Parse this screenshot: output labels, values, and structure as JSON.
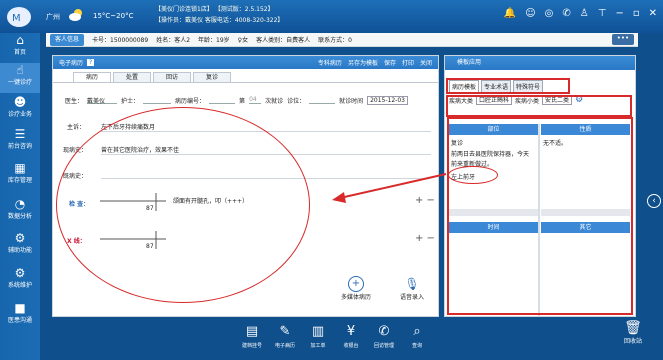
{
  "topbar": {
    "city": "广州",
    "temp": "15°C~20°C",
    "info1": "【美仪门诊连锁1店】  【测试版：2.5.152】",
    "info2": "【操作员：戴美仪  客服电话：4008-320-322】"
  },
  "sidebar": [
    {
      "label": "首页",
      "icon": "home-icon"
    },
    {
      "label": "一键诊疗",
      "icon": "hand-icon"
    },
    {
      "label": "诊疗业务",
      "icon": "doctor-icon"
    },
    {
      "label": "前台咨询",
      "icon": "counter-icon"
    },
    {
      "label": "库存管理",
      "icon": "store-icon"
    },
    {
      "label": "数据分析",
      "icon": "chart-icon"
    },
    {
      "label": "辅助功能",
      "icon": "gear-icon"
    },
    {
      "label": "系统维护",
      "icon": "system-icon"
    },
    {
      "label": "医患沟通",
      "icon": "video-icon"
    }
  ],
  "patient": {
    "btn": "客人信息",
    "card": "卡号：1500000089",
    "name": "姓名：客人2",
    "age": "年龄：19岁",
    "gender": "♀女",
    "type": "客人类别：自费客人",
    "contact": "联系方式：0"
  },
  "more_btn": "•••",
  "main": {
    "title": "电子病历",
    "hbtn1": "专科病历",
    "hbtn2": "另存为模板",
    "hbtn3": "保存",
    "hbtn4": "打印",
    "hbtn5": "关闭",
    "tabs": [
      "病历",
      "处置",
      "回访",
      "复诊"
    ],
    "doctor_lbl": "医生：",
    "doctor_val": "戴美仪",
    "nurse_lbl": "护士：",
    "case_lbl": "病历编号：",
    "visit_lbl": "第",
    "visit_no": "04",
    "visit_suffix": "次就诊",
    "room_lbl": "诊位：",
    "time_lbl": "就诊时间",
    "date": "2015-12-03",
    "complaint_lbl": "主诉：",
    "complaint": "左下后牙持续痛数月",
    "present_lbl": "现病史：",
    "present": "曾在其它医院治疗，效果不佳",
    "past_lbl": "既病史：",
    "check_lbl": "检 查：",
    "check_text": "颌面有开髓孔，叩（+++）",
    "check_tooth": "87",
    "xray_lbl": "X 线：",
    "xray_tooth": "87",
    "media_btn": "多媒体病历",
    "voice_btn": "语音录入"
  },
  "right": {
    "title": "模板应用",
    "tabs": [
      "病历模板",
      "专业术语",
      "特殊符号"
    ],
    "cat_lbl": "疾病大类",
    "cat_val": "口腔正畸科",
    "sub_lbl": "疾病小类",
    "sub_val": "安氏二类",
    "col1": "部位",
    "col2": "性质",
    "col3": "时间",
    "col4": "其它",
    "part_items": [
      "复诊",
      "前两日去县医院保持器，今天",
      "前来重新做过。",
      "左上前牙"
    ],
    "nature_items": [
      "无不适。"
    ]
  },
  "dock": [
    {
      "label": "建档挂号",
      "icon": "register-icon"
    },
    {
      "label": "电子病历",
      "icon": "record-icon"
    },
    {
      "label": "加工单",
      "icon": "process-icon"
    },
    {
      "label": "收银台",
      "icon": "cashier-icon"
    },
    {
      "label": "回访管理",
      "icon": "phone-icon"
    },
    {
      "label": "查询",
      "icon": "query-icon"
    }
  ],
  "trash": "回收站"
}
